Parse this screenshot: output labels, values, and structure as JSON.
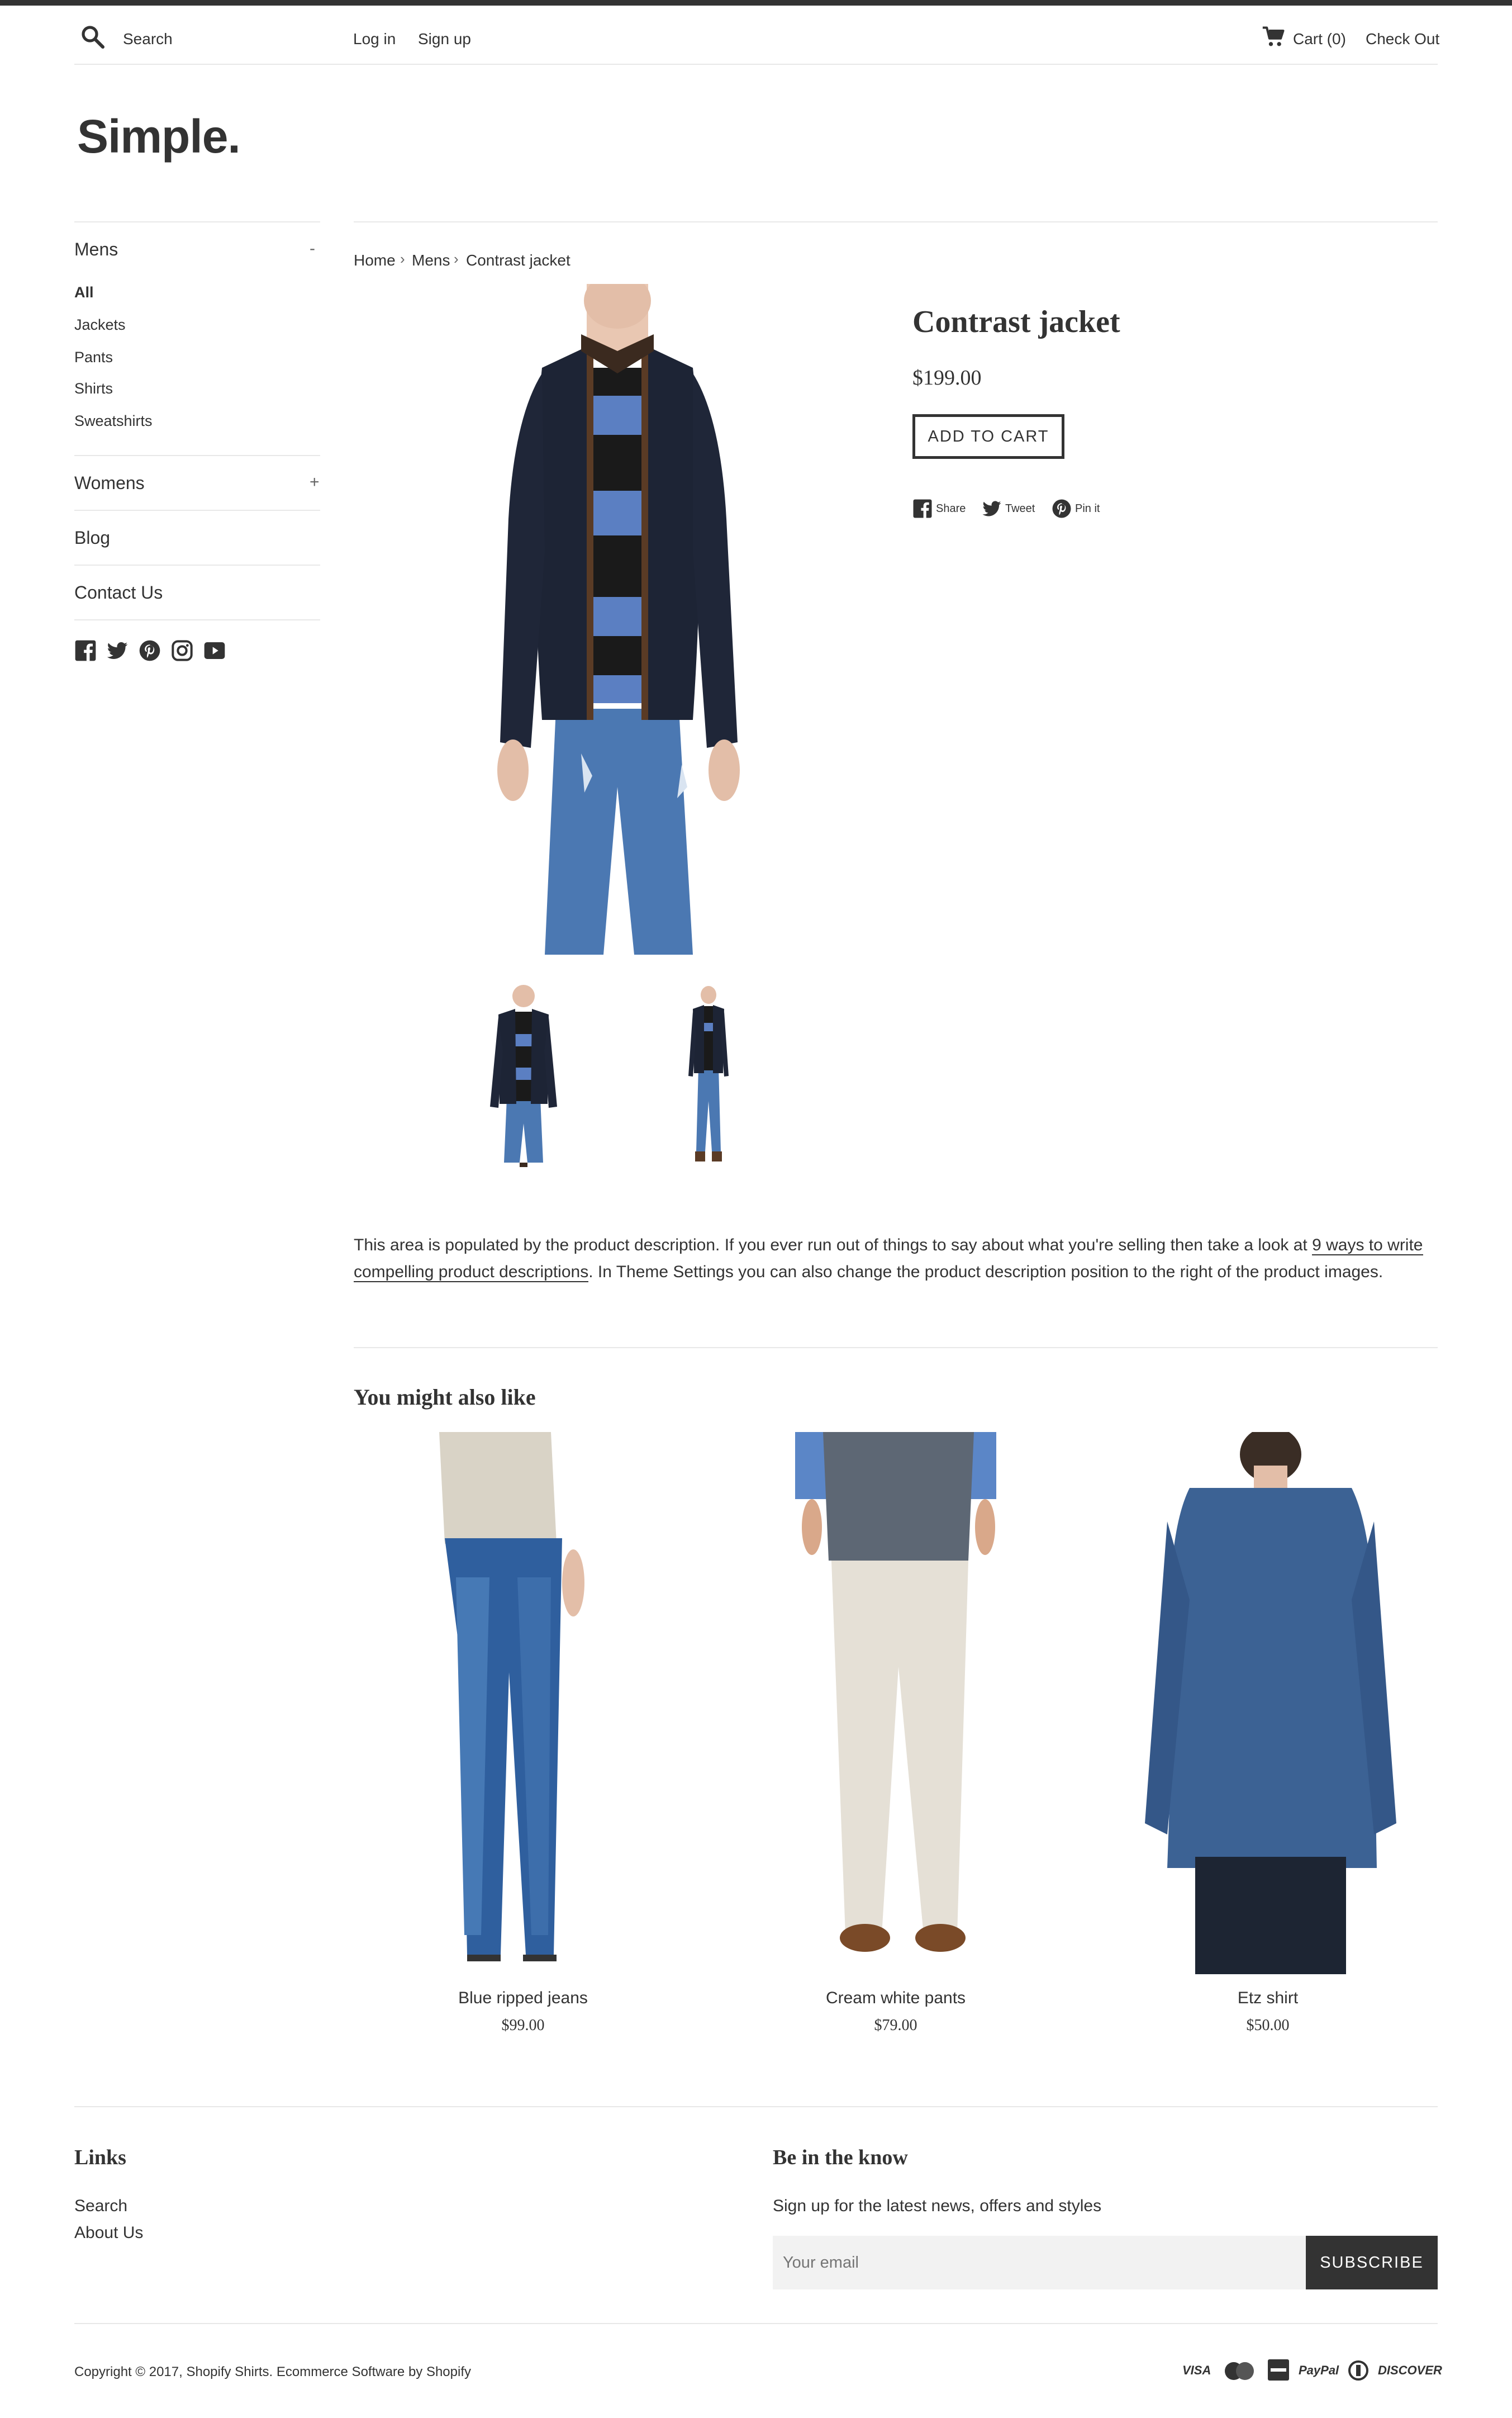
{
  "header": {
    "search_label": "Search",
    "login": "Log in",
    "signup": "Sign up",
    "cart": "Cart (0)",
    "checkout": "Check Out"
  },
  "logo": "Simple.",
  "sidebar": {
    "mens": {
      "label": "Mens",
      "toggle": "-",
      "items": [
        "All",
        "Jackets",
        "Pants",
        "Shirts",
        "Sweatshirts"
      ]
    },
    "womens": {
      "label": "Womens",
      "toggle": "+"
    },
    "blog": "Blog",
    "contact": "Contact Us",
    "social": [
      "facebook-icon",
      "twitter-icon",
      "pinterest-icon",
      "instagram-icon",
      "youtube-icon"
    ]
  },
  "breadcrumb": [
    "Home",
    "Mens",
    "Contrast jacket"
  ],
  "product": {
    "title": "Contrast jacket",
    "price": "$199.00",
    "add_to_cart": "ADD TO CART",
    "share": "Share",
    "tweet": "Tweet",
    "pin": "Pin it"
  },
  "description": {
    "part1": "This area is populated by the product description. If you ever run out of things to say about what you're selling then take a look at ",
    "link": "9 ways to write compelling product descriptions",
    "part2": ". In Theme Settings you can also change the product description position to the right of the product images."
  },
  "related": {
    "heading": "You might also like",
    "items": [
      {
        "name": "Blue ripped jeans",
        "price": "$99.00"
      },
      {
        "name": "Cream white pants",
        "price": "$79.00"
      },
      {
        "name": "Etz shirt",
        "price": "$50.00"
      }
    ]
  },
  "footer": {
    "links_heading": "Links",
    "links": [
      "Search",
      "About Us"
    ],
    "know_heading": "Be in the know",
    "know_text": "Sign up for the latest news, offers and styles",
    "email_placeholder": "Your email",
    "subscribe": "SUBSCRIBE",
    "copyright": "Copyright © 2017, Shopify Shirts. Ecommerce Software by Shopify",
    "payments": [
      "VISA",
      "PayPal",
      "DISCOVER"
    ]
  },
  "colors": {
    "text": "#333333",
    "rule": "#e8e8e8",
    "jacket": "#1d2435",
    "denim": "#3e6aa3"
  }
}
